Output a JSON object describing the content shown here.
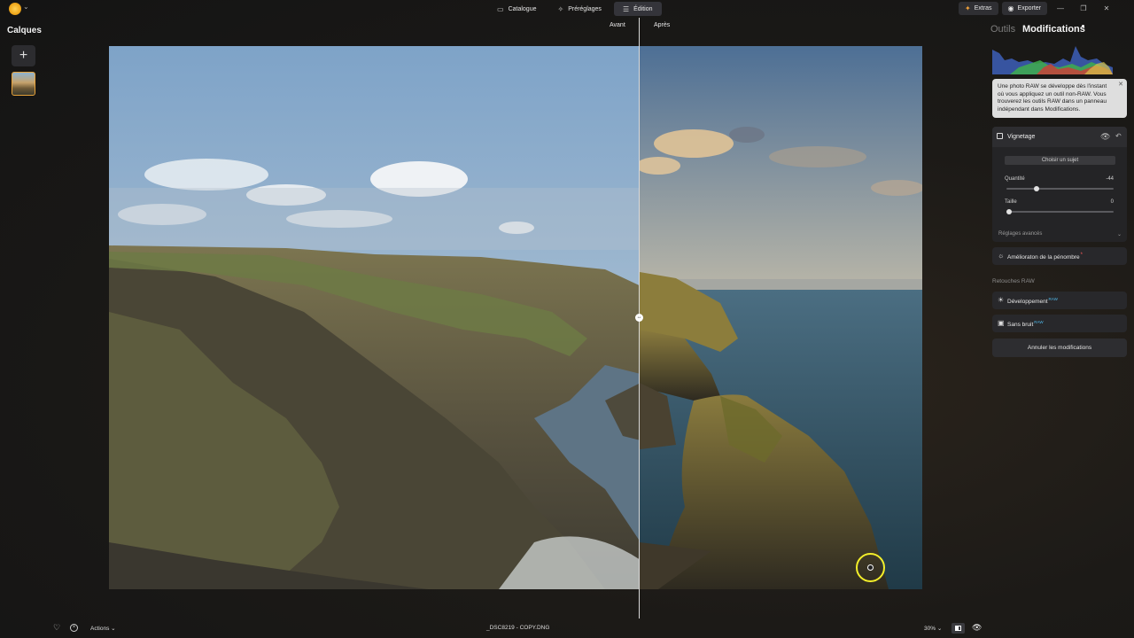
{
  "app": {
    "logo_icon": "sun-logo-icon"
  },
  "top_tabs": [
    {
      "label": "Catalogue",
      "icon": "catalog-icon"
    },
    {
      "label": "Préréglages",
      "icon": "presets-icon"
    },
    {
      "label": "Édition",
      "icon": "menu-lines-icon",
      "active": true
    }
  ],
  "top_right": {
    "extras": "Extras",
    "export": "Exporter"
  },
  "left_panel": {
    "title": "Calques",
    "add_icon": "+"
  },
  "compare": {
    "before": "Avant",
    "after": "Après"
  },
  "right_panel": {
    "tab_tools": "Outils",
    "tab_modifications": "Modifications",
    "info_text": "Une photo RAW se développe dès l'instant où vous appliquez un outil non-RAW. Vous trouverez les outils RAW dans un panneau indépendant dans Modifications.",
    "vignetting": {
      "title": "Vignetage",
      "choose_subject": "Choisir un sujet",
      "amount_label": "Quantité",
      "amount_value": "-44",
      "amount_fraction": 0.28,
      "size_label": "Taille",
      "size_value": "0",
      "size_fraction": 0.0,
      "advanced": "Réglages avancés"
    },
    "shadow_tool": {
      "label": "Amélioraton de la pénombre",
      "badge": "*"
    },
    "raw_section": "Retouches RAW",
    "development": {
      "label": "Développement",
      "badge": "RAW"
    },
    "denoise": {
      "label": "Sans bruit",
      "badge": "RAW"
    },
    "cancel": "Annuler les modifications"
  },
  "bottom_bar": {
    "actions": "Actions",
    "filename": "_DSC8219 - COPY.DNG",
    "zoom": "30%"
  },
  "colors": {
    "accent": "#e8a33a",
    "cursor_ring": "#f3ee2a",
    "raw_badge": "#4fb8e8"
  }
}
